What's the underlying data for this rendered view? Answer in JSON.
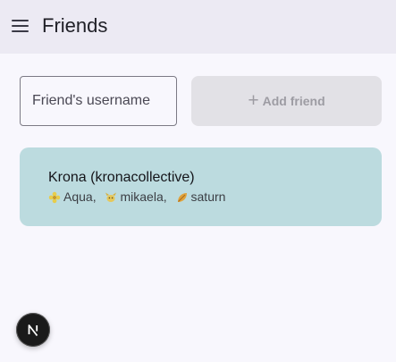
{
  "header": {
    "title": "Friends",
    "menu_icon": "hamburger-menu-icon"
  },
  "add_friend": {
    "input_placeholder": "Friend's username",
    "input_value": "",
    "button_label": "Add friend",
    "button_icon": "plus-icon",
    "button_enabled": false
  },
  "friends": [
    {
      "display_name": "Krona (kronacollective)",
      "pets": [
        {
          "name": "Aqua",
          "icon": "yellow-flower-icon",
          "separator": ","
        },
        {
          "name": "mikaela",
          "icon": "yellow-creature-icon",
          "separator": ","
        },
        {
          "name": "saturn",
          "icon": "orange-leaf-icon",
          "separator": ""
        }
      ]
    }
  ],
  "dev_badge": {
    "letter": "N",
    "icon": "nextjs-logo-icon"
  },
  "colors": {
    "header_bg": "#eceaf3",
    "page_bg": "#f8f7fd",
    "card_bg": "#bcdbdf",
    "button_disabled_bg": "#e2e1e6"
  }
}
